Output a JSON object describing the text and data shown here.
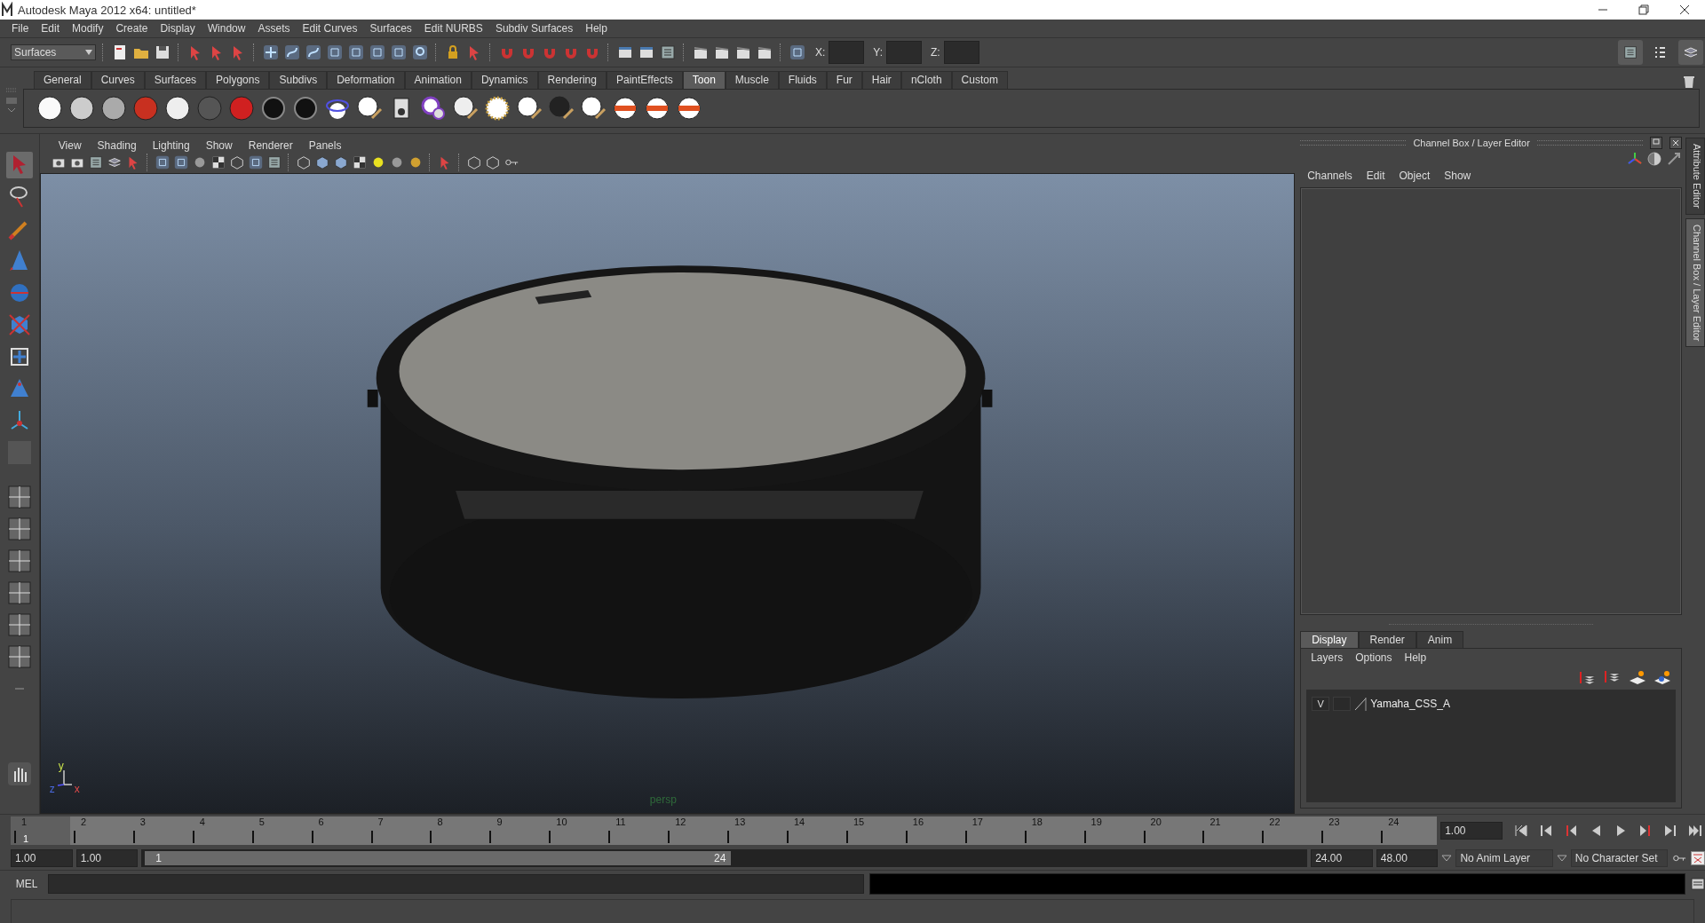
{
  "window": {
    "title": "Autodesk Maya 2012 x64: untitled*"
  },
  "menu_bar": [
    "File",
    "Edit",
    "Modify",
    "Create",
    "Display",
    "Window",
    "Assets",
    "Edit Curves",
    "Surfaces",
    "Edit NURBS",
    "Subdiv Surfaces",
    "Help"
  ],
  "status_line": {
    "menu_set": "Surfaces",
    "coord_labels": [
      "X:",
      "Y:",
      "Z:"
    ]
  },
  "shelf": {
    "tabs": [
      {
        "label": "General",
        "selected": false
      },
      {
        "label": "Curves",
        "selected": false
      },
      {
        "label": "Surfaces",
        "selected": false
      },
      {
        "label": "Polygons",
        "selected": false
      },
      {
        "label": "Subdivs",
        "selected": false
      },
      {
        "label": "Deformation",
        "selected": false
      },
      {
        "label": "Animation",
        "selected": false
      },
      {
        "label": "Dynamics",
        "selected": false
      },
      {
        "label": "Rendering",
        "selected": false
      },
      {
        "label": "PaintEffects",
        "selected": false
      },
      {
        "label": "Toon",
        "selected": true
      },
      {
        "label": "Muscle",
        "selected": false
      },
      {
        "label": "Fluids",
        "selected": false
      },
      {
        "label": "Fur",
        "selected": false
      },
      {
        "label": "Hair",
        "selected": false
      },
      {
        "label": "nCloth",
        "selected": false
      },
      {
        "label": "Custom",
        "selected": false
      }
    ]
  },
  "panel_menu": [
    "View",
    "Shading",
    "Lighting",
    "Show",
    "Renderer",
    "Panels"
  ],
  "viewport": {
    "camera_label": "persp",
    "axis_labels": [
      "y",
      "x",
      "z"
    ]
  },
  "channel_box": {
    "title": "Channel Box / Layer Editor",
    "menu": [
      "Channels",
      "Edit",
      "Object",
      "Show"
    ]
  },
  "layer_editor": {
    "tabs": [
      {
        "label": "Display",
        "selected": true
      },
      {
        "label": "Render",
        "selected": false
      },
      {
        "label": "Anim",
        "selected": false
      }
    ],
    "menu": [
      "Layers",
      "Options",
      "Help"
    ],
    "layers": [
      {
        "visibility": "V",
        "name": "Yamaha_CSS_A"
      }
    ]
  },
  "side_tabs": [
    {
      "label": "Attribute Editor",
      "selected": false
    },
    {
      "label": "Channel Box / Layer Editor",
      "selected": true
    }
  ],
  "time_slider": {
    "frames": [
      {
        "label": "1",
        "selected": true
      },
      {
        "label": "2",
        "selected": false
      },
      {
        "label": "3",
        "selected": false
      },
      {
        "label": "4",
        "selected": false
      },
      {
        "label": "5",
        "selected": false
      },
      {
        "label": "6",
        "selected": false
      },
      {
        "label": "7",
        "selected": false
      },
      {
        "label": "8",
        "selected": false
      },
      {
        "label": "9",
        "selected": false
      },
      {
        "label": "10",
        "selected": false
      },
      {
        "label": "11",
        "selected": false
      },
      {
        "label": "12",
        "selected": false
      },
      {
        "label": "13",
        "selected": false
      },
      {
        "label": "14",
        "selected": false
      },
      {
        "label": "15",
        "selected": false
      },
      {
        "label": "16",
        "selected": false
      },
      {
        "label": "17",
        "selected": false
      },
      {
        "label": "18",
        "selected": false
      },
      {
        "label": "19",
        "selected": false
      },
      {
        "label": "20",
        "selected": false
      },
      {
        "label": "21",
        "selected": false
      },
      {
        "label": "22",
        "selected": false
      },
      {
        "label": "23",
        "selected": false
      },
      {
        "label": "24",
        "selected": false
      }
    ],
    "current_frame": "1",
    "current_time": "1.00"
  },
  "range_slider": {
    "start_time": "1.00",
    "playback_start": "1.00",
    "range_start": "1",
    "range_end": "24",
    "playback_end": "24.00",
    "end_time": "48.00",
    "anim_layer": "No Anim Layer",
    "character_set": "No Character Set"
  },
  "command_line": {
    "language": "MEL"
  }
}
